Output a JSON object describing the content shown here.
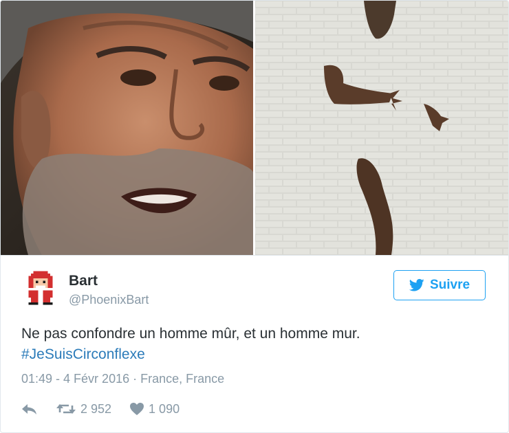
{
  "tweet": {
    "author_name": "Bart",
    "author_handle": "@PhoenixBart",
    "follow_label": "Suivre",
    "text_line1": "Ne pas confondre un homme mûr, et un homme mur.",
    "hashtag": "#JeSuisCirconflexe",
    "meta": "01:49 - 4 Févr 2016 · France, France",
    "retweets": "2 952",
    "likes": "1 090"
  },
  "colors": {
    "accent": "#1da1f2",
    "hashtag": "#2b7bb9",
    "muted": "#8899a6",
    "text": "#292f33",
    "border": "#e1e8ed"
  },
  "icons": {
    "follow": "twitter-bird-icon",
    "reply": "reply-icon",
    "retweet": "retweet-icon",
    "like": "heart-icon"
  }
}
